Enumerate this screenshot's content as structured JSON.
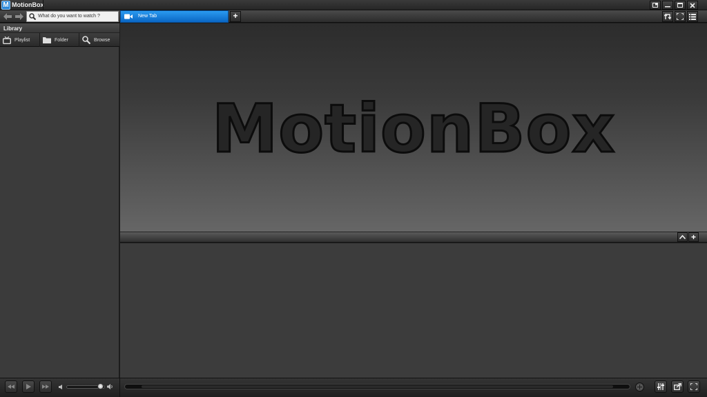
{
  "window": {
    "title": "MotionBox",
    "icon_letter": "M",
    "controls": [
      "restore-icon",
      "minimize-icon",
      "maximize-icon",
      "close-icon"
    ]
  },
  "navigation": {
    "back_icon": "arrow-left-icon",
    "forward_icon": "arrow-right-icon"
  },
  "search": {
    "placeholder": "What do you want to watch ?",
    "icon": "search-icon"
  },
  "tabs": [
    {
      "label": "New Tab",
      "icon": "video-camera-icon",
      "active": true
    }
  ],
  "add_tab_label": "+",
  "toolbar_icons": [
    "swap-icon",
    "fullscreen-icon",
    "list-icon"
  ],
  "sidebar": {
    "header": "Library",
    "buttons": [
      {
        "label": "Playlist",
        "icon": "tv-icon"
      },
      {
        "label": "Folder",
        "icon": "folder-icon"
      },
      {
        "label": "Browse",
        "icon": "search-icon"
      }
    ]
  },
  "splash": {
    "logo_text": "MotionBox"
  },
  "panel": {
    "collapse_icon": "chevron-up-icon",
    "add_label": "+"
  },
  "player": {
    "buttons": [
      "previous-icon",
      "play-icon",
      "next-icon"
    ],
    "volume_level": 0.9,
    "seek_position": 0,
    "right_buttons": [
      "equalizer-icon",
      "share-icon",
      "fullscreen-icon"
    ],
    "colors": {
      "accent": "#1479d4",
      "background": "#3c3c3c"
    }
  }
}
